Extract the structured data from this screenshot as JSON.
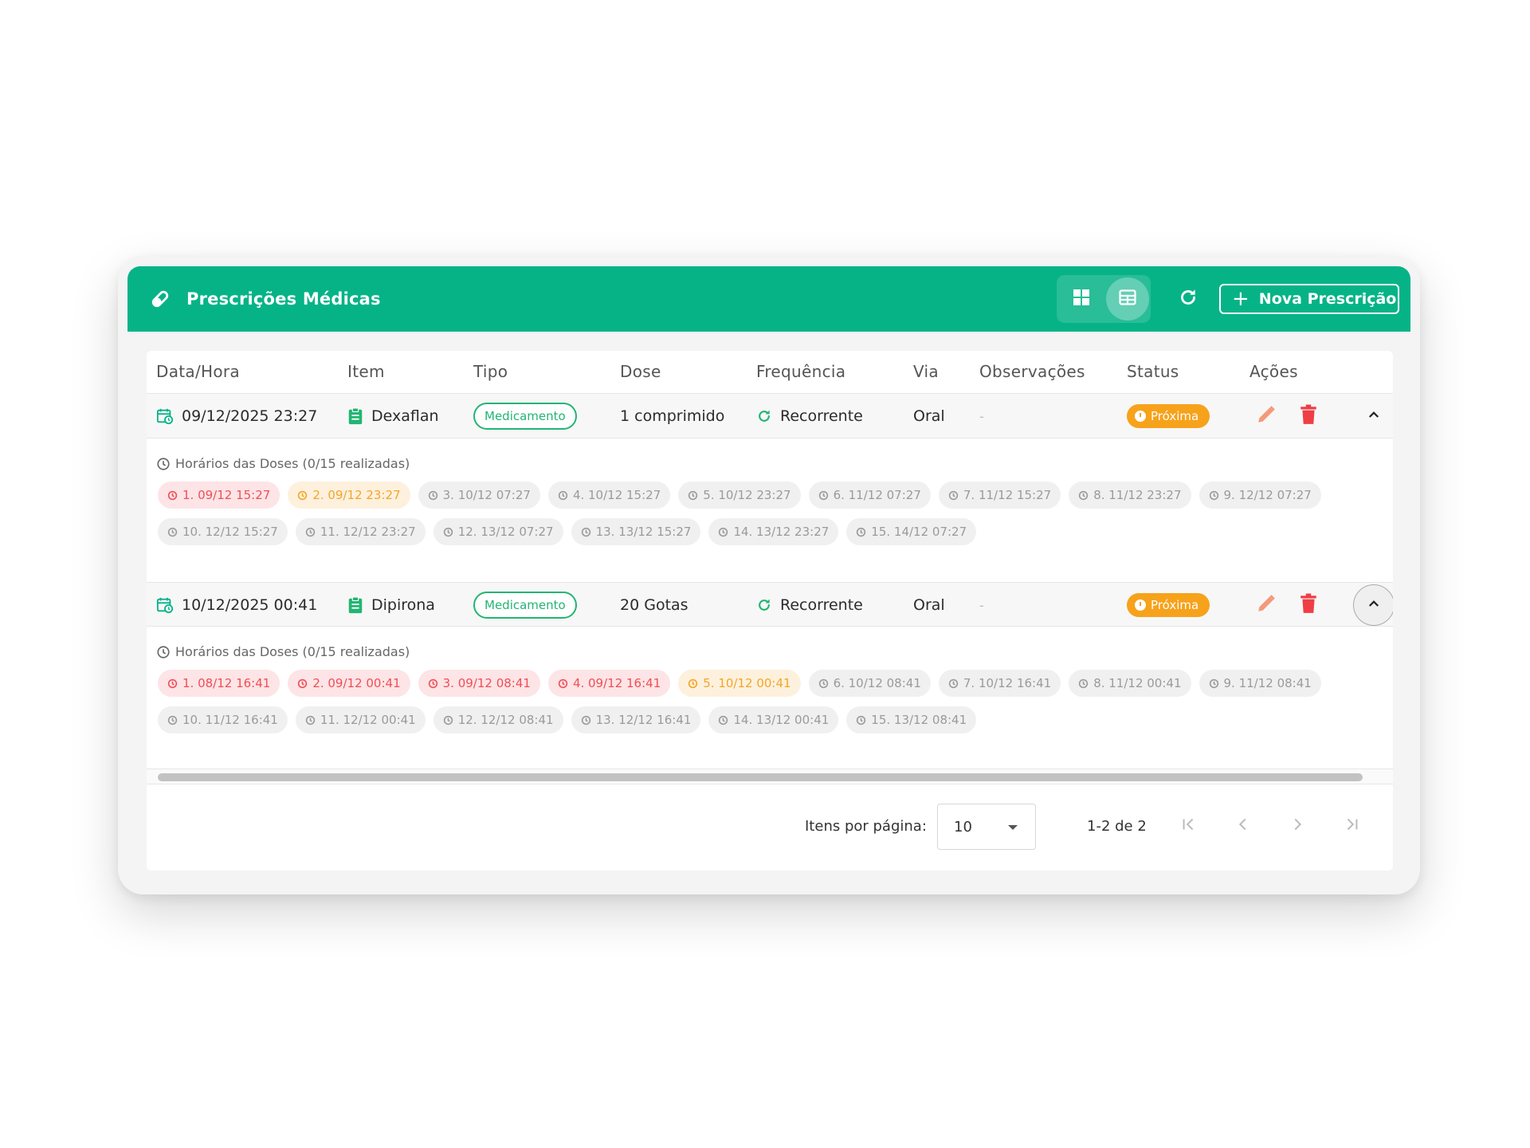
{
  "header": {
    "title": "Prescrições Médicas",
    "new_button_label": "Nova Prescrição",
    "accent_color": "#06b387"
  },
  "table": {
    "columns": [
      "Data/Hora",
      "Item",
      "Tipo",
      "Dose",
      "Frequência",
      "Via",
      "Observações",
      "Status",
      "Ações"
    ],
    "rows": [
      {
        "datetime": "09/12/2025 23:27",
        "item": "Dexaflan",
        "tipo": "Medicamento",
        "dose": "1 comprimido",
        "frequencia": "Recorrente",
        "via": "Oral",
        "observacoes": "-",
        "status": "Próxima",
        "detail_title": "Horários das Doses (0/15 realizadas)",
        "doses_line1": [
          "1. 09/12 15:27",
          "2. 09/12 23:27",
          "3. 10/12 07:27",
          "4. 10/12 15:27",
          "5. 10/12 23:27",
          "6. 11/12 07:27",
          "7. 11/12 15:27",
          "8. 11/12 23:27",
          "9. 12/12 07:27"
        ],
        "doses_line2": [
          "10. 12/12 15:27",
          "11. 12/12 23:27",
          "12. 13/12 07:27",
          "13. 13/12 15:27",
          "14. 13/12 23:27",
          "15. 14/12 07:27"
        ]
      },
      {
        "datetime": "10/12/2025 00:41",
        "item": "Dipirona",
        "tipo": "Medicamento",
        "dose": "20 Gotas",
        "frequencia": "Recorrente",
        "via": "Oral",
        "observacoes": "-",
        "status": "Próxima",
        "detail_title": "Horários das Doses (0/15 realizadas)",
        "doses_line1": [
          "1. 08/12 16:41",
          "2. 09/12 00:41",
          "3. 09/12 08:41",
          "4. 09/12 16:41",
          "5. 10/12 00:41",
          "6. 10/12 08:41",
          "7. 10/12 16:41",
          "8. 11/12 00:41",
          "9. 11/12 08:41"
        ],
        "doses_line2": [
          "10. 11/12 16:41",
          "11. 12/12 00:41",
          "12. 12/12 08:41",
          "13. 12/12 16:41",
          "14. 13/12 00:41",
          "15. 13/12 08:41"
        ]
      }
    ]
  },
  "paginator": {
    "items_per_page_label": "Itens por página:",
    "items_per_page_value": "10",
    "range_label": "1-2 de 2"
  }
}
